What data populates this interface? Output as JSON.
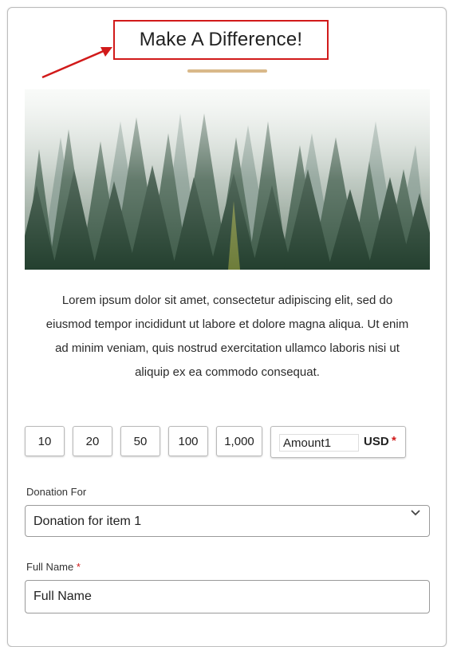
{
  "header": {
    "title": "Make A Difference!"
  },
  "colors": {
    "annotation_red": "#d11a1a",
    "accent_gold": "#d9b98a"
  },
  "hero": {
    "alt": "forest"
  },
  "description": "Lorem ipsum dolor sit amet, consectetur adipiscing elit, sed do eiusmod tempor incididunt ut labore et dolore magna aliqua. Ut enim ad minim veniam, quis nostrud exercitation ullamco laboris nisi ut aliquip ex ea commodo consequat.",
  "amounts": {
    "presets": [
      "10",
      "20",
      "50",
      "100",
      "1,000"
    ],
    "custom_value": "Amount1",
    "currency": "USD",
    "required_mark": "*"
  },
  "donation_for": {
    "label": "Donation For",
    "selected": "Donation for item 1",
    "icon": "chevron-down-icon"
  },
  "full_name": {
    "label": "Full Name",
    "required_mark": "*",
    "placeholder": "Full Name"
  }
}
